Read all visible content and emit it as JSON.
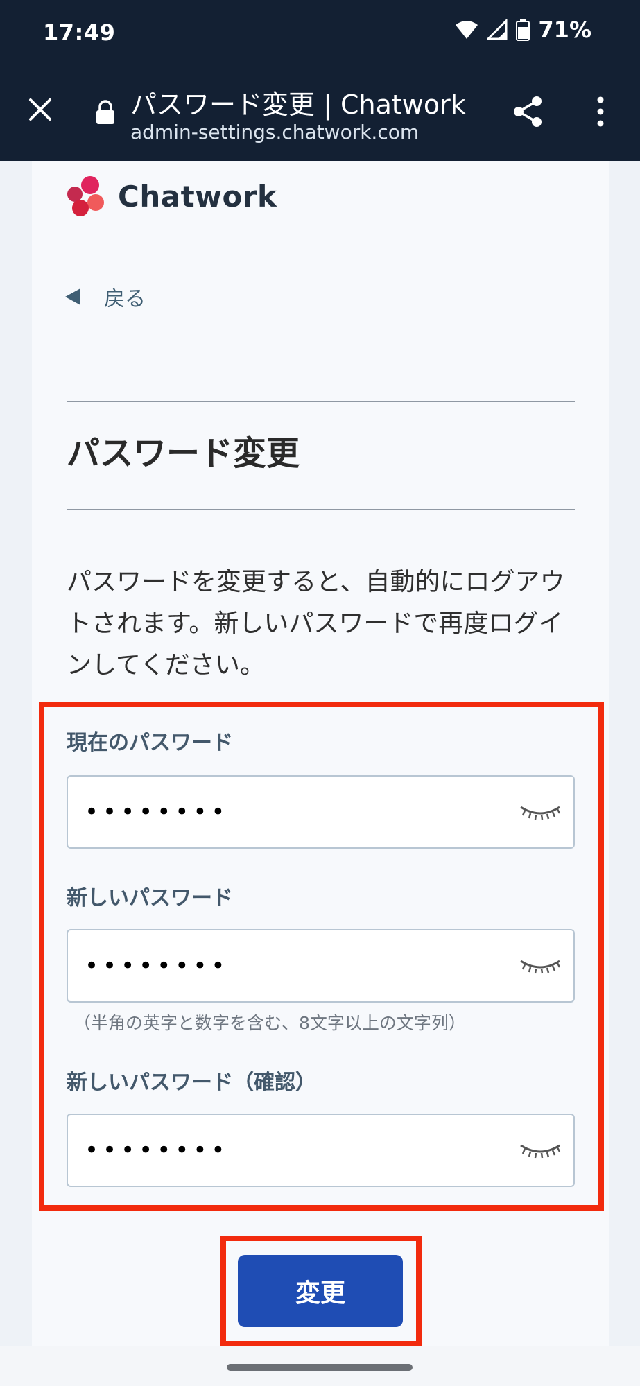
{
  "status": {
    "time": "17:49",
    "battery": "71%"
  },
  "tab": {
    "title": "パスワード変更 | Chatwork",
    "url": "admin-settings.chatwork.com"
  },
  "brand": {
    "name": "Chatwork",
    "colors": [
      "#e0245e",
      "#c42a4f",
      "#f05a5b",
      "#d4213d"
    ]
  },
  "nav": {
    "back_label": "戻る"
  },
  "page": {
    "title": "パスワード変更",
    "description": "パスワードを変更すると、自動的にログアウトされます。新しいパスワードで再度ログインしてください。"
  },
  "form": {
    "current": {
      "label": "現在のパスワード",
      "value": "••••••••"
    },
    "new": {
      "label": "新しいパスワード",
      "value": "••••••••",
      "hint": "（半角の英字と数字を含む、8文字以上の文字列）"
    },
    "confirm": {
      "label": "新しいパスワード（確認）",
      "value": "••••••••"
    },
    "submit_label": "変更"
  },
  "icons": {
    "close": "close-icon",
    "lock": "lock-icon",
    "share": "share-icon",
    "more": "more-vertical-icon",
    "eye": "eye-closed-icon"
  },
  "colors": {
    "chrome_bg": "#132033",
    "primary_button": "#1f4db4",
    "highlight": "#f22b0e"
  }
}
